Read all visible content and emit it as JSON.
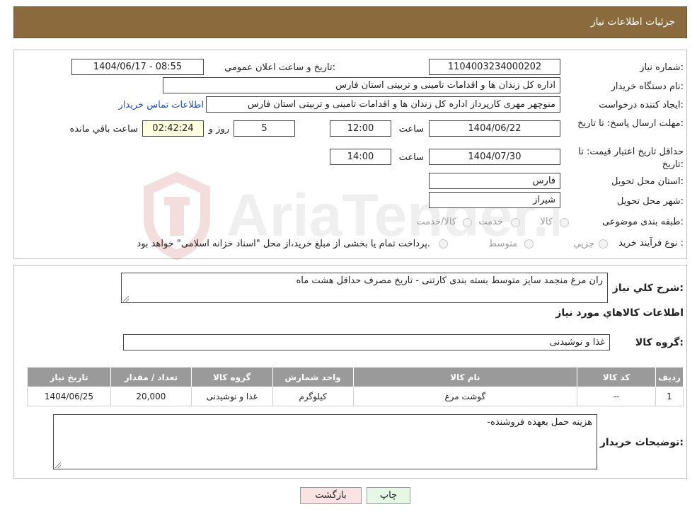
{
  "header": {
    "title": "جزئیات اطلاعات نیاز"
  },
  "form": {
    "need_number_label": "شماره نیاز:",
    "need_number": "1104003234000202",
    "announce_label": "تاريخ و ساعت اعلان عمومي:",
    "announce_value": "1404/06/17 - 08:55",
    "buyer_label": "نام دستگاه خريدار:",
    "buyer_value": "اداره کل زندان ها و اقدامات تامینی و تربیتی استان فارس",
    "creator_label": "ايجاد کننده درخواست:",
    "creator_value": "منوچهر  مهری  کارپرداز اداره کل زندان ها و اقدامات تامینی و تربیتی استان فارس",
    "contact_link": "اطلاعات تماس خريدار",
    "deadline_label": "مهلت ارسال پاسخ: تا تاريخ:",
    "deadline_date": "1404/06/22",
    "time_label": "ساعت",
    "deadline_time": "12:00",
    "days_value": "5",
    "days_label": "روز و",
    "remaining_time": "02:42:24",
    "remaining_label": "ساعت باقي مانده",
    "validity_label": "حداقل تاريخ اعتبار قيمت: تا تاريخ:",
    "validity_date": "1404/07/30",
    "validity_time": "14:00",
    "province_label": "استان محل تحويل:",
    "province_value": "فارس",
    "city_label": "شهر محل تحويل:",
    "city_value": "شیراز",
    "category_label": "طبقه بندی موضوعی:",
    "category_options": [
      "کالا",
      "خدمت",
      "کالا/خدمت"
    ],
    "process_label": "نوع فرآيند خريد :",
    "process_options": [
      "جزيي",
      "متوسط"
    ],
    "process_note": "پرداخت تمام يا بخشی از مبلغ خريد،از محل \"اسناد خزانه اسلامی\" خواهد بود."
  },
  "details": {
    "summary_label": "شرح کلي نياز:",
    "summary_value": "ران مرغ منجمد سایز متوسط بسته بندی کارتنی - تاریخ مصرف حداقل هشت ماه",
    "goods_info_title": "اطلاعات کالاهاي مورد نياز",
    "goods_group_label": "گروه کالا:",
    "goods_group_value": "غذا و نوشیدنی",
    "table": {
      "headers": [
        "رديف",
        "کد کالا",
        "نام کالا",
        "واحد شمارش",
        "گروه کالا",
        "تعداد / مقدار",
        "تاريخ نياز"
      ],
      "rows": [
        [
          "1",
          "--",
          "گوشت مرغ",
          "کیلوگرم",
          "غذا و نوشیدنی",
          "20,000",
          "1404/06/25"
        ]
      ]
    },
    "buyer_notes_label": "توضيحات خريدار:",
    "buyer_notes_value": "هزینه حمل بعهده فروشنده-"
  },
  "buttons": {
    "print": "چاپ",
    "back": "بازگشت"
  },
  "watermark": {
    "text": "AriaTender.neT"
  },
  "colors": {
    "header_bg": "#8b6b3d",
    "table_header_bg": "#9a9a9a",
    "link": "#1f4fbf",
    "back_button_bg": "#fbe3e3",
    "print_button_bg": "#e6f7e6"
  }
}
